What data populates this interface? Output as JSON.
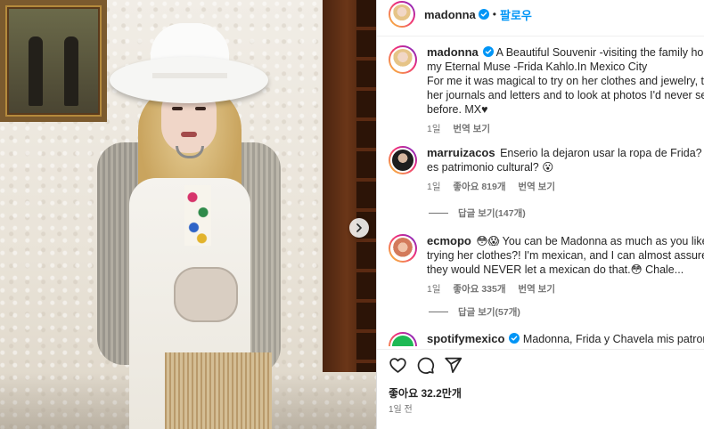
{
  "post_header": {
    "username": "madonna",
    "separator": "•",
    "follow_label": "팔로우"
  },
  "caption": {
    "username": "madonna",
    "lines": [
      "A Beautiful Souvenir -visiting the family home of",
      "my Eternal Muse -Frida Kahlo.In Mexico City",
      "For me it was magical to try on her clothes and jewelry, to read",
      "her journals and letters and to look at photos I'd never seen",
      "before. MX♥"
    ],
    "time": "1일",
    "translate_label": "번역 보기"
  },
  "comments": [
    {
      "username": "marruizacos",
      "lines": [
        "Enserio la dejaron usar la ropa de Frida? No que",
        "es patrimonio cultural? 😮"
      ],
      "time": "1일",
      "likes": "좋아요 819개",
      "translate_label": "번역 보기",
      "replies_label": "답글 보기(147개)"
    },
    {
      "username": "ecmopo",
      "lines": [
        "😳😱 You can be Madonna as much as you like, but",
        "trying her clothes?! I'm mexican, and I can almost assure you",
        "they would NEVER let a mexican do that.😳 Chale..."
      ],
      "time": "1일",
      "likes": "좋아요 335개",
      "translate_label": "번역 보기",
      "replies_label": "답글 보기(57개)"
    },
    {
      "username": "spotifymexico",
      "lines": [
        "Madonna, Frida y Chavela mis patronas"
      ]
    }
  ],
  "actions": {
    "likes_label": "좋아요 32.2만개",
    "date_label": "1일 전"
  },
  "colors": {
    "accent": "#0095f6",
    "verified": "#0095f6",
    "secondary_text": "#737373",
    "border": "#dbdbdb"
  },
  "icons": [
    "next-arrow-icon",
    "verified-badge-icon",
    "heart-icon",
    "comment-icon",
    "share-icon"
  ]
}
